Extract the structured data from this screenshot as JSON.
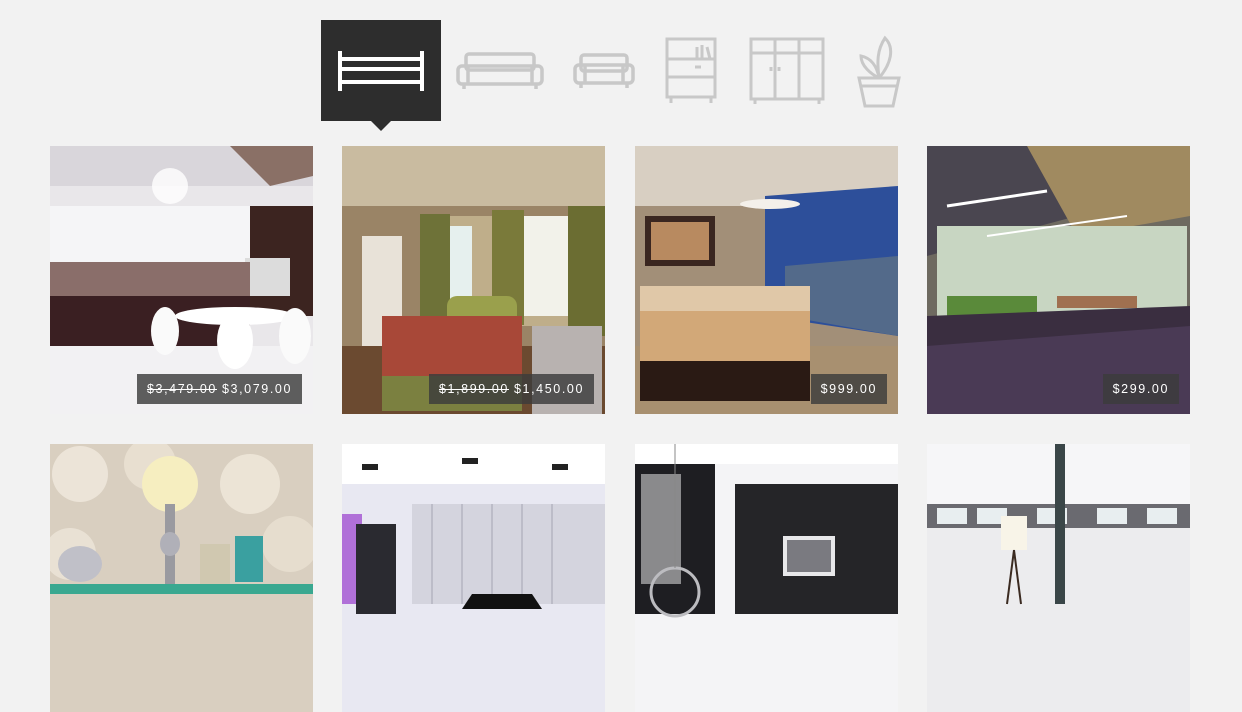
{
  "category_tabs": [
    {
      "icon": "bed-icon",
      "active": true
    },
    {
      "icon": "sofa-icon",
      "active": false
    },
    {
      "icon": "armchair-icon",
      "active": false
    },
    {
      "icon": "bookshelf-icon",
      "active": false
    },
    {
      "icon": "wardrobe-icon",
      "active": false
    },
    {
      "icon": "plant-icon",
      "active": false
    }
  ],
  "colors": {
    "background": "#f2f2f2",
    "active_tab": "#2d2d2d",
    "icon_active": "#ffffff",
    "icon_inactive": "#c8c8c8",
    "price_tag": "#3c3c3c"
  },
  "products": [
    {
      "image": "white kitchen with dining table",
      "old_price": "$3,479.00",
      "price": "$3,079.00"
    },
    {
      "image": "bedroom with green curtains",
      "old_price": "$1,899.00",
      "price": "$1,450.00"
    },
    {
      "image": "bedroom with city view windows",
      "old_price": "",
      "price": "$999.00"
    },
    {
      "image": "loft living and dining area",
      "old_price": "",
      "price": "$299.00"
    },
    {
      "image": "decorative wall with lamp and vases",
      "old_price": "",
      "price": ""
    },
    {
      "image": "white living room with piano",
      "old_price": "",
      "price": ""
    },
    {
      "image": "black and white living room with hanging chair",
      "old_price": "",
      "price": ""
    },
    {
      "image": "white loft with tall windows",
      "old_price": "",
      "price": ""
    }
  ]
}
